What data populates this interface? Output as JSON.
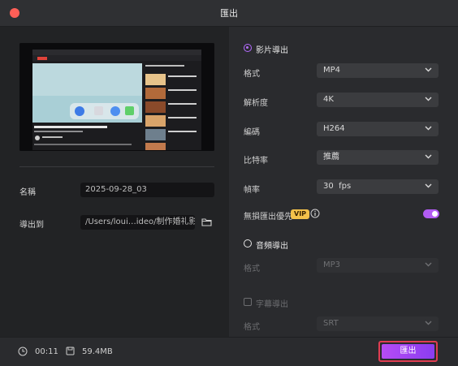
{
  "window": {
    "title": "匯出"
  },
  "left": {
    "name_label": "名稱",
    "name_value": "2025-09-28_03",
    "export_to_label": "導出到",
    "export_path": "/Users/loui…ideo/制作婚礼影片"
  },
  "video_section": {
    "title": "影片導出",
    "format_label": "格式",
    "format_value": "MP4",
    "resolution_label": "解析度",
    "resolution_value": "4K",
    "encoder_label": "編碼",
    "encoder_value": "H264",
    "bitrate_label": "比特率",
    "bitrate_value": "推薦",
    "framerate_label": "幀率",
    "framerate_value": "30  fps",
    "lossless_label": "無損匯出優先",
    "vip_badge": "VIP"
  },
  "audio_section": {
    "title": "音頻導出",
    "format_label": "格式",
    "format_value": "MP3"
  },
  "subtitle_section": {
    "title": "字幕導出",
    "format_label": "格式",
    "format_value": "SRT"
  },
  "footer": {
    "duration": "00:11",
    "size": "59.4MB",
    "export_button": "匯出"
  },
  "colors": {
    "accent": "#b25cf2",
    "highlight_border": "#e03d52"
  }
}
